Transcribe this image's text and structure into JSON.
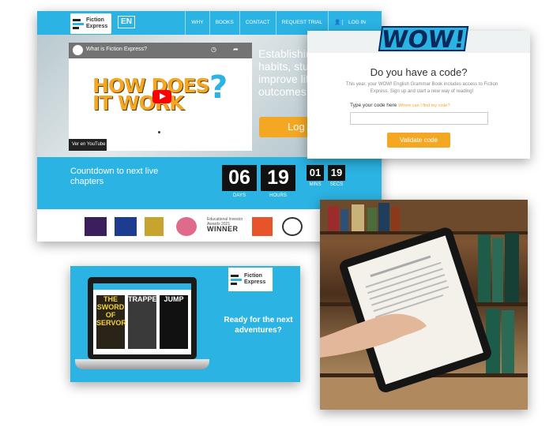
{
  "site": {
    "logo_text": "Fiction Express",
    "lang": "EN",
    "nav": [
      "WHY",
      "BOOKS",
      "CONTACT",
      "REQUEST TRIAL",
      "LOG IN"
    ],
    "video": {
      "title": "What is Fiction Express?",
      "headline_line1": "HOW DOES",
      "headline_line2": "IT WORK",
      "headline_mark": "?",
      "youtube_label": "Ver en YouTube"
    },
    "hero_text": "Establishing reading habits, students to improve life, learning outcomes",
    "login_button": "Log",
    "countdown": {
      "title": "Countdown to next live chapters",
      "days": "06",
      "hours": "19",
      "mins": "01",
      "secs": "19",
      "days_label": "DAYS",
      "hours_label": "HOURS",
      "mins_label": "MINS",
      "secs_label": "SECS"
    },
    "awards": {
      "educational_investor": "Educational Investor Awards 2021",
      "winner": "WINNER"
    }
  },
  "modal": {
    "badge": "WOW!",
    "title": "Do you have a code?",
    "description": "This year, your WOW! English Grammar Book includes access to Fiction Express. Sign up and start a new way of reading!",
    "label": "Type your code here",
    "link": "Where can I find my code?",
    "input_value": "",
    "button": "Validate code"
  },
  "banner": {
    "logo_text": "Fiction Express",
    "books": [
      "THE SWORD OF SERVOR",
      "TRAPPED",
      "JUMP"
    ],
    "tagline": "Ready for the next adventures?"
  },
  "colors": {
    "brand_blue": "#2bb3e3",
    "brand_orange": "#f4a723"
  }
}
